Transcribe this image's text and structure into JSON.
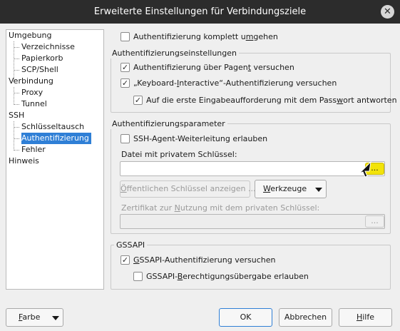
{
  "window": {
    "title": "Erweiterte Einstellungen für Verbindungsziele",
    "close_glyph": "✕"
  },
  "tree": {
    "items": [
      {
        "label": "Umgebung"
      },
      {
        "label": "Verzeichnisse"
      },
      {
        "label": "Papierkorb"
      },
      {
        "label": "SCP/Shell"
      },
      {
        "label": "Verbindung"
      },
      {
        "label": "Proxy"
      },
      {
        "label": "Tunnel"
      },
      {
        "label": "SSH"
      },
      {
        "label": "Schlüsseltausch"
      },
      {
        "label": "Authentifizierung",
        "selected": true
      },
      {
        "label": "Fehler"
      },
      {
        "label": "Hinweis"
      }
    ]
  },
  "bypass_auth": {
    "checked": false,
    "label_pre": "Authentifizierung komplett u",
    "label_u": "m",
    "label_post": "gehen"
  },
  "auth_settings": {
    "title": "Authentifizierungseinstellungen",
    "pageant": {
      "checked": true,
      "label_pre": "Authentifizierung über Pagen",
      "label_u": "t",
      "label_post": " versuchen"
    },
    "keyboard": {
      "checked": true,
      "label_pre": "„Keyboard-",
      "label_u": "I",
      "label_post": "nteractive“-Authentifizierung versuchen"
    },
    "password_first": {
      "checked": true,
      "label_pre": "Auf die erste Eingabeaufforderung mit dem Pass",
      "label_u": "w",
      "label_post": "ort antworten"
    }
  },
  "auth_params": {
    "title": "Authentifizierungsparameter",
    "agent_fwd": {
      "checked": false,
      "label": "SSH-Agent-Weiterleitung erlauben"
    },
    "private_key_label": "Datei mit privatem Schlüssel:",
    "private_key_value": "",
    "browse_label": "...",
    "show_public_key": {
      "label_pre": "",
      "label_u": "Ö",
      "label_post": "ffentlichen Schlüssel anzeigen ..."
    },
    "tools": {
      "label_pre": "",
      "label_u": "W",
      "label_post": "erkzeuge"
    },
    "cert_label_pre": "Zertifikat zur ",
    "cert_label_u": "N",
    "cert_label_post": "utzung mit dem privaten Schlüssel:",
    "cert_value": "",
    "cert_browse_label": "..."
  },
  "gssapi": {
    "title": "GSSAPI",
    "try": {
      "checked": true,
      "label_pre": "",
      "label_u": "G",
      "label_post": "SSAPI-Authentifizierung versuchen"
    },
    "delegation": {
      "checked": false,
      "label_pre": "GSSAPI-",
      "label_u": "B",
      "label_post": "erechtigungsübergabe erlauben"
    }
  },
  "footer": {
    "color": {
      "label_pre": "",
      "label_u": "F",
      "label_post": "arbe"
    },
    "ok": "OK",
    "cancel": "Abbrechen",
    "help": {
      "label_pre": "",
      "label_u": "H",
      "label_post": "ilfe"
    }
  },
  "check_glyph": "✓",
  "accent_color": "#2f7fd6",
  "cursor_highlight_color": "#f2e30a"
}
